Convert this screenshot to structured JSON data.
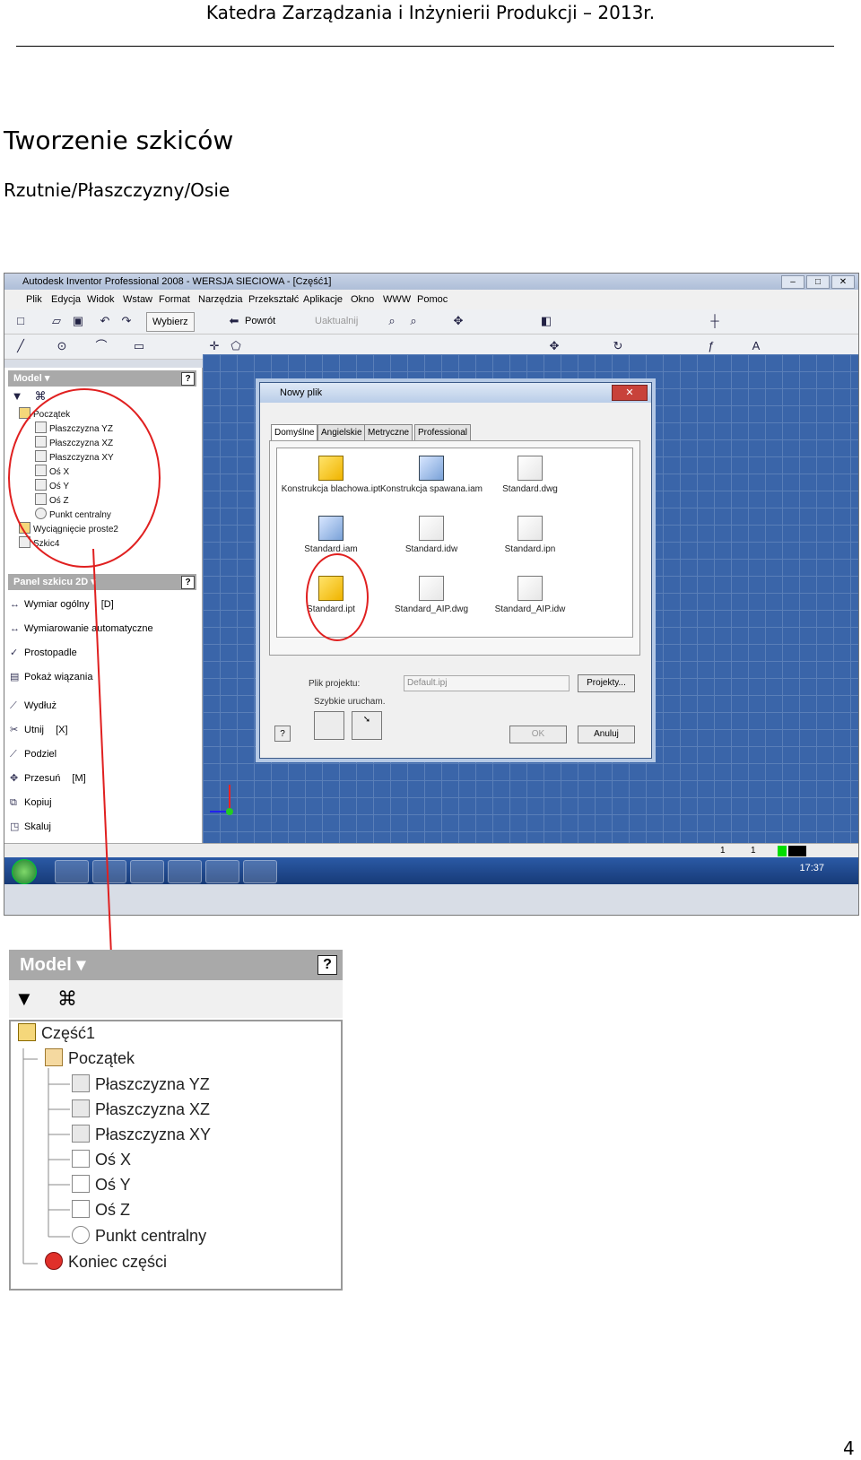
{
  "header": "Katedra Zarządzania i Inżynierii Produkcji – 2013r.",
  "title": "Tworzenie szkiców",
  "subtitle": "Rzutnie/Płaszczyzny/Osie",
  "page_number": "4",
  "screenshot": {
    "window_title": "Autodesk Inventor Professional 2008 - WERSJA SIECIOWA - [Część1]",
    "menu": [
      "Plik",
      "Edycja",
      "Widok",
      "Wstaw",
      "Format",
      "Narzędzia",
      "Przekształć",
      "Aplikacje",
      "Okno",
      "WWW",
      "Pomoc"
    ],
    "toolbar": {
      "select_label": "Wybierz",
      "back_label": "Powrót",
      "update_label": "Uaktualnij"
    },
    "browser": {
      "title": "Model",
      "items": [
        "Początek",
        "Płaszczyzna YZ",
        "Płaszczyzna XZ",
        "Płaszczyzna XY",
        "Oś X",
        "Oś Y",
        "Oś Z",
        "Punkt centralny",
        "Wyciągnięcie proste2",
        "Szkic4"
      ]
    },
    "sketch_panel": {
      "title": "Panel szkicu 2D",
      "items": [
        {
          "label": "Wymiar ogólny",
          "key": "[D]"
        },
        {
          "label": "Wymiarowanie automatyczne",
          "key": ""
        },
        {
          "label": "Prostopadle",
          "key": ""
        },
        {
          "label": "Pokaż wiązania",
          "key": ""
        },
        {
          "label": "Wydłuż",
          "key": ""
        },
        {
          "label": "Utnij",
          "key": "[X]"
        },
        {
          "label": "Podziel",
          "key": ""
        },
        {
          "label": "Przesuń",
          "key": "[M]"
        },
        {
          "label": "Kopiuj",
          "key": ""
        },
        {
          "label": "Skaluj",
          "key": ""
        }
      ]
    },
    "dialog": {
      "title": "Nowy plik",
      "tabs": [
        "Domyślne",
        "Angielskie",
        "Metryczne",
        "Professional"
      ],
      "templates": [
        "Konstrukcja blachowa.ipt",
        "Konstrukcja spawana.iam",
        "Standard.dwg",
        "Standard.iam",
        "Standard.idw",
        "Standard.ipn",
        "Standard.ipt",
        "Standard_AIP.dwg",
        "Standard_AIP.idw"
      ],
      "project_label": "Plik projektu:",
      "project_value": "Default.ipj",
      "projects_button": "Projekty...",
      "quick_launch": "Szybkie urucham.",
      "ok": "OK",
      "cancel": "Anuluj"
    },
    "status": {
      "v1": "1",
      "v2": "1"
    },
    "clock": "17:37"
  },
  "zoom_panel": {
    "title": "Model",
    "items": [
      "Część1",
      "Początek",
      "Płaszczyzna YZ",
      "Płaszczyzna XZ",
      "Płaszczyzna XY",
      "Oś X",
      "Oś Y",
      "Oś Z",
      "Punkt centralny",
      "Koniec części"
    ]
  },
  "colors": {
    "accent_red": "#e02020",
    "canvas": "#3a65a9",
    "panel_header": "#a9a9a9"
  }
}
